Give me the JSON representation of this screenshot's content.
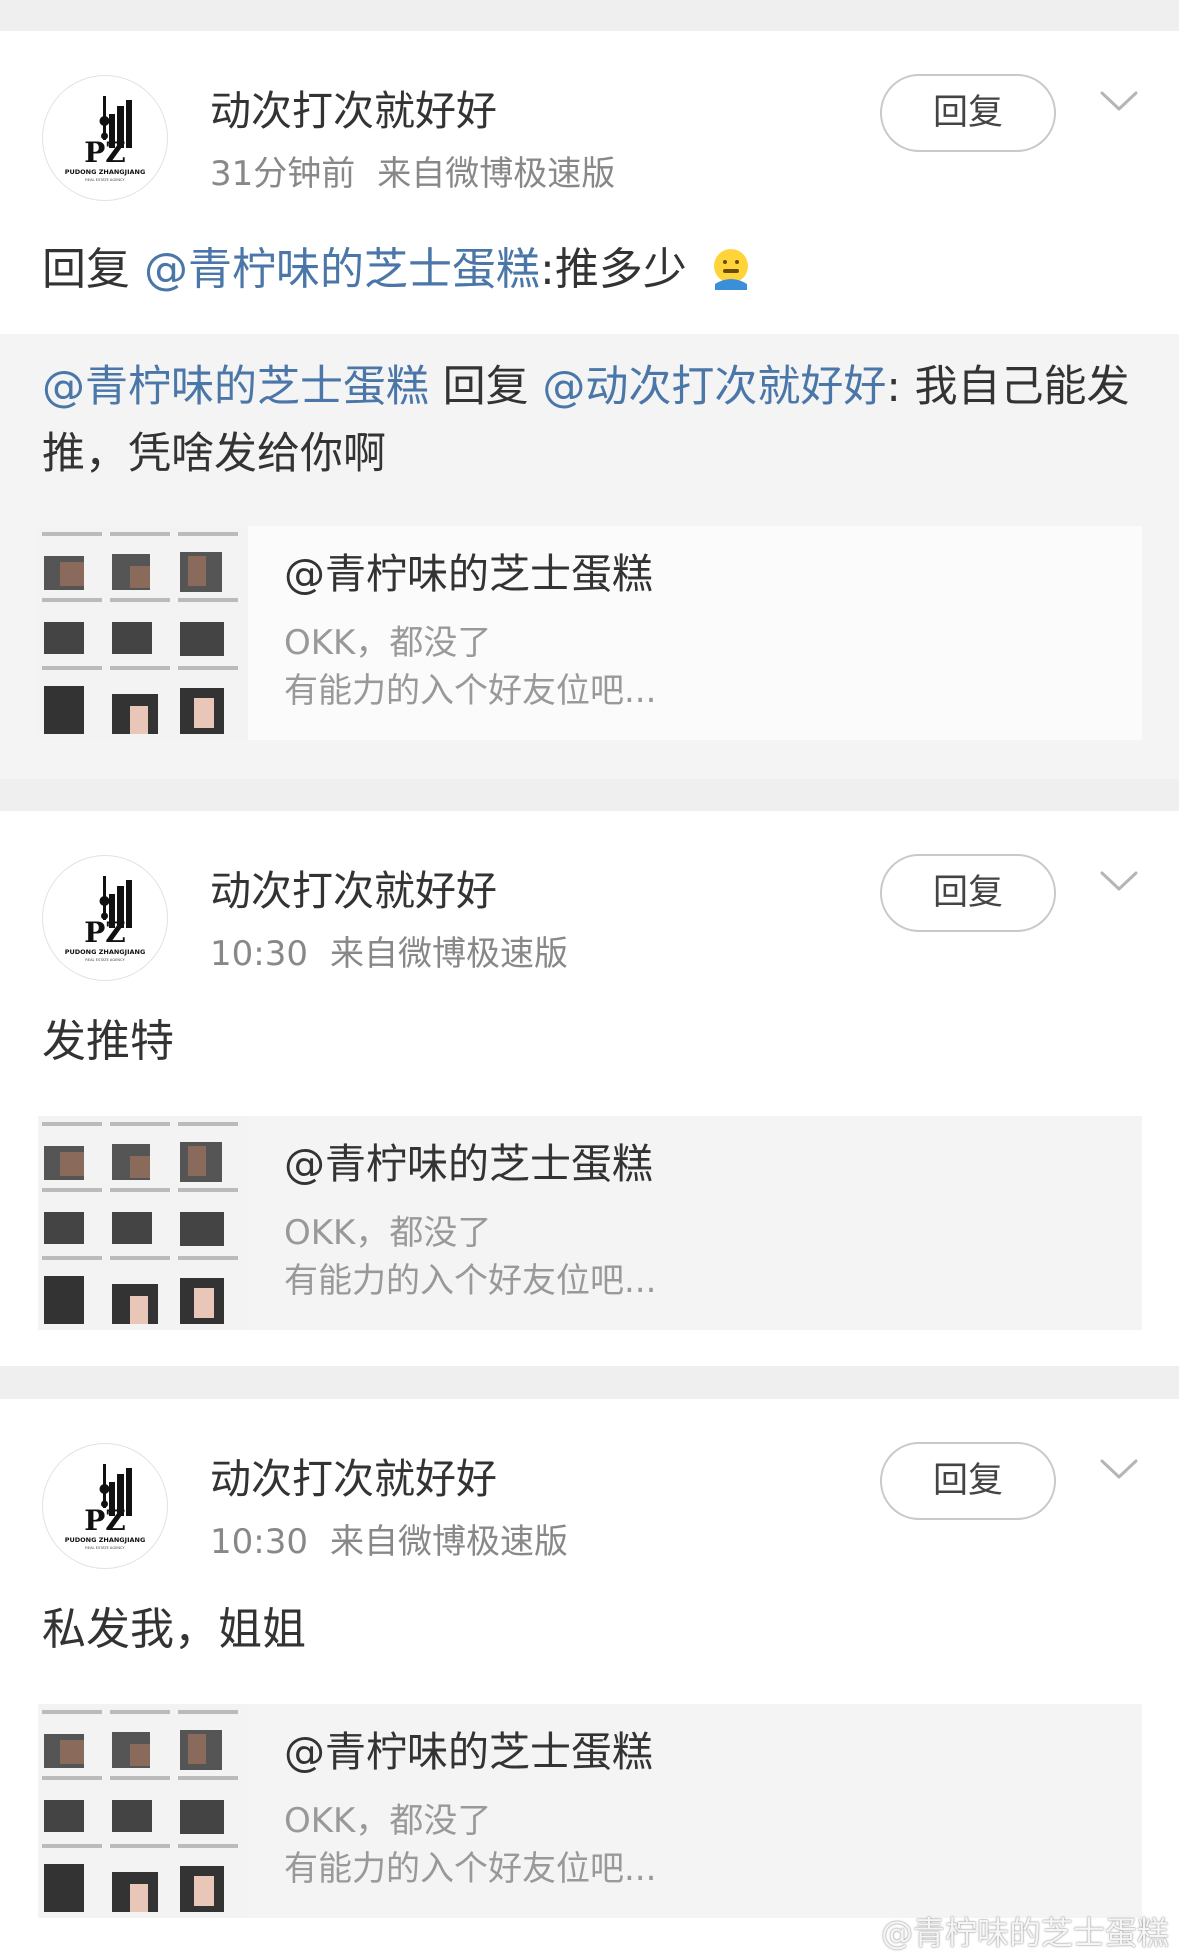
{
  "posts": [
    {
      "username": "动次打次就好好",
      "time": "31分钟前",
      "source": "来自微博极速版",
      "reply_label": "回复",
      "content_prefix": "回复 ",
      "content_mention": "@青柠味的芝士蛋糕",
      "content_suffix": ":推多少",
      "quote": {
        "mention1": "@青柠味的芝士蛋糕",
        "mid": " 回复 ",
        "mention2": "@动次打次就好好",
        "text": ": 我自己能发推，凭啥发给你啊"
      },
      "share": {
        "title": "@青柠味的芝士蛋糕",
        "line1": "OKK，都没了",
        "line2": "有能力的入个好友位吧..."
      }
    },
    {
      "username": "动次打次就好好",
      "time": "10:30",
      "source": "来自微博极速版",
      "reply_label": "回复",
      "content": "发推特",
      "share": {
        "title": "@青柠味的芝士蛋糕",
        "line1": "OKK，都没了",
        "line2": "有能力的入个好友位吧..."
      }
    },
    {
      "username": "动次打次就好好",
      "time": "10:30",
      "source": "来自微博极速版",
      "reply_label": "回复",
      "content": "私发我，姐姐",
      "share": {
        "title": "@青柠味的芝士蛋糕",
        "line1": "OKK，都没了",
        "line2": "有能力的入个好友位吧..."
      }
    }
  ],
  "avatar_text": {
    "brand": "PUDONG ZHANGJIANG",
    "sub": "REAL ESTATE AGENCY",
    "mark": "PZ"
  },
  "watermark": "@青柠味的芝士蛋糕",
  "colors": {
    "mention": "#4a76a8",
    "background": "#efefef",
    "meta": "#888888"
  },
  "icons": [
    "chevron-down-icon",
    "emoji-icon",
    "weibo-logo-icon"
  ]
}
